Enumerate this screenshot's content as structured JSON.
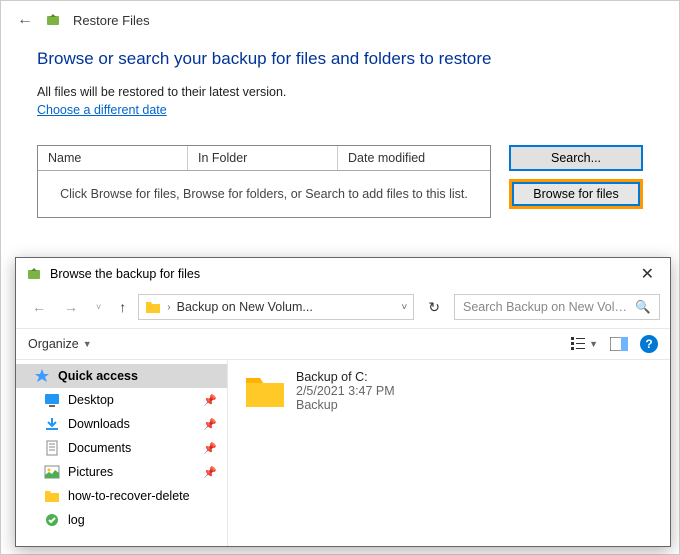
{
  "restore": {
    "title": "Restore Files",
    "heading": "Browse or search your backup for files and folders to restore",
    "subtext": "All files will be restored to their latest version.",
    "link": "Choose a different date",
    "columns": {
      "name": "Name",
      "folder": "In Folder",
      "modified": "Date modified"
    },
    "empty_msg": "Click Browse for files, Browse for folders, or Search to add files to this list.",
    "buttons": {
      "search": "Search...",
      "browse_files": "Browse for files"
    }
  },
  "dialog": {
    "title": "Browse the backup for files",
    "close": "✕",
    "address": "Backup on New Volum...",
    "search_placeholder": "Search Backup on New Volum...",
    "organize": "Organize",
    "nav": {
      "quick_access": "Quick access",
      "desktop": "Desktop",
      "downloads": "Downloads",
      "documents": "Documents",
      "pictures": "Pictures",
      "how_to": "how-to-recover-delete",
      "log": "log"
    },
    "content": {
      "name": "Backup of C:",
      "date": "2/5/2021 3:47 PM",
      "type": "Backup"
    }
  }
}
